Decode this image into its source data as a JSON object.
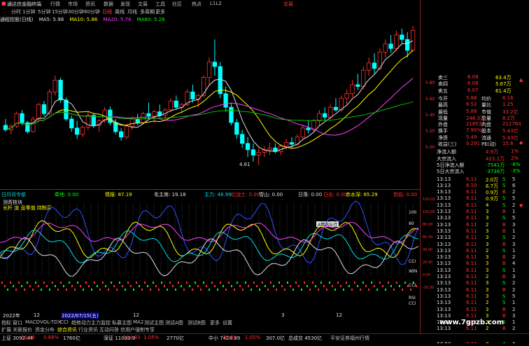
{
  "menu": {
    "app_title": "通达信金融终端",
    "items": [
      "行情",
      "市场",
      "资讯",
      "数据",
      "发现",
      "文易",
      "工具",
      "社区",
      "热点",
      "L1L2"
    ],
    "right_label": "交易"
  },
  "timeframes": [
    "分时",
    "1分钟",
    "5分钟",
    "15分钟",
    "30分钟",
    "60分钟",
    "日线",
    "周线",
    "月线",
    "多周期",
    "更多"
  ],
  "active_timeframe_index": 6,
  "ma_legend": {
    "name": "通程控股(日线)",
    "items": [
      {
        "label": "MA5: 5.98",
        "color": "#e0e0e0"
      },
      {
        "label": "MA10: 5.86",
        "color": "#ffff00"
      },
      {
        "label": "MA20: 5.74",
        "color": "#ff40ff"
      },
      {
        "label": "MA60: 5.26",
        "color": "#00ff00"
      }
    ]
  },
  "price_axis": [
    "5.80",
    "5.60",
    "5.40",
    "5.20",
    "5.00",
    "4.80"
  ],
  "chart_annotations": {
    "low_label": "4.61"
  },
  "indicator_legend": [
    {
      "label": "日月司令部",
      "color": "#00e0e0"
    },
    {
      "label": "牵地: 0.00",
      "color": "#00ff00"
    },
    {
      "label": "情报: 87.19",
      "color": "#ffff00"
    },
    {
      "label": "毛主席: 19.18",
      "color": "#e0e0e0"
    },
    {
      "label": "主力: 48.99",
      "color": "#00e0e0"
    },
    {
      "label": "红战士: 0.00",
      "color": "#ff3030"
    },
    {
      "label": "雪山: 0.00",
      "color": "#e0e0e0"
    },
    {
      "label": "日落: 0.00",
      "color": "#e0e0e0"
    },
    {
      "label": "日出: 0.00",
      "color": "#ff3030"
    },
    {
      "label": "赤水深: 65.29",
      "color": "#ffff00"
    },
    {
      "label": "到低: 0.00",
      "color": "#ff3030"
    }
  ],
  "lower_panel": {
    "title": "测青核块",
    "subtitle": "长杆 道 品零值 持制买",
    "tooltip": "A精选五行",
    "left_axis": [
      "120.00",
      "100.00",
      "80.00",
      "60.00",
      "40.00",
      "20.00",
      "0.00",
      "-20.00"
    ],
    "right_labels": [
      "100",
      "80",
      "CCI",
      "WIN",
      "CCI",
      "RSI",
      "CCI"
    ]
  },
  "date_bar": {
    "items": [
      "2022年",
      "12",
      "2022/07/15(五)",
      "12",
      "3",
      "12"
    ]
  },
  "tabs": [
    "指标",
    "窗口",
    "MACD",
    "VOL-TDX",
    "CCI",
    "趋势动力",
    "主力监控",
    "私募主图",
    "MA2",
    "测试主图",
    "测试A图",
    "测试B图",
    "更多",
    "设置"
  ],
  "tabs2": [
    "扩展",
    "关联报价",
    "资金分布",
    "综合资讯",
    "行业资讯",
    "互动问答",
    "信用户强制专享"
  ],
  "right_panel": {
    "asks": [
      {
        "label": "卖三",
        "price": "6.09",
        "vol": "63.4万"
      },
      {
        "label": "卖四",
        "price": "6.08",
        "vol": "5.67万"
      },
      {
        "label": "卖五",
        "price": "6.07",
        "vol": "61.4万"
      }
    ],
    "stats": [
      {
        "l1": "今开",
        "v1": "5.88",
        "l2": "均价",
        "v2": "6.16"
      },
      {
        "l1": "最高",
        "v1": "6.52",
        "l2": "量比",
        "v2": "1.25"
      },
      {
        "l1": "最低",
        "v1": "5.88",
        "l2": "市值",
        "v2": "33.2亿"
      },
      {
        "l1": "现量",
        "v1": "248.3万",
        "l2": "总量",
        "v2": "8.2万"
      },
      {
        "l1": "外盘",
        "v1": "216533",
        "l2": "内盘",
        "v2": "212764"
      },
      {
        "l1": "换手",
        "v1": "7.90%",
        "l2": "股本",
        "v2": "5.43亿"
      },
      {
        "l1": "净资",
        "v1": "5.49",
        "l2": "流通",
        "v2": "5.43亿"
      },
      {
        "l1": "收益(三)",
        "v1": "0.291",
        "l2": "PE(动)",
        "v2": "15.6"
      }
    ],
    "flows": [
      {
        "label": "净流入额",
        "value": "4.9万",
        "pct": "1%"
      },
      {
        "label": "大宗流入",
        "value": "423.1万",
        "pct": "2%"
      },
      {
        "label": "5日净流入额",
        "value": "-7541万",
        "pct": "-6%"
      },
      {
        "label": "5日大宗流入",
        "value": "-3738万",
        "pct": "-3%"
      }
    ],
    "ticks": [
      {
        "t": "13:13",
        "p": "6.11",
        "v": "2.0万",
        "d": "S",
        "n": "5"
      },
      {
        "t": "13:13",
        "p": "6.10",
        "v": "6.7万",
        "d": "S",
        "n": "6"
      },
      {
        "t": "13:13",
        "p": "6.11",
        "v": "0.9万",
        "d": "B",
        "n": "2"
      },
      {
        "t": "13:13",
        "p": "6.11",
        "v": "0.9万",
        "d": "S",
        "n": "5"
      },
      {
        "t": "13:13",
        "p": "6.11",
        "v": "4",
        "d": "S",
        "n": "2"
      },
      {
        "t": "13:13",
        "p": "6.11",
        "v": "3",
        "d": "B",
        "n": "1"
      },
      {
        "t": "13:13",
        "p": "6.11",
        "v": "3",
        "d": "S",
        "n": "5"
      },
      {
        "t": "13:13",
        "p": "6.11",
        "v": "2",
        "d": "B",
        "n": "3"
      },
      {
        "t": "13:13",
        "p": "6.11",
        "v": "3",
        "d": "B",
        "n": "1"
      },
      {
        "t": "13:13",
        "p": "6.11",
        "v": "3",
        "d": "S",
        "n": "2"
      },
      {
        "t": "13:13",
        "p": "6.11",
        "v": "3",
        "d": "B",
        "n": "3"
      },
      {
        "t": "13:13",
        "p": "6.11",
        "v": "2",
        "d": "S",
        "n": "1"
      },
      {
        "t": "13:13",
        "p": "6.11",
        "v": "3",
        "d": "B",
        "n": "2"
      },
      {
        "t": "13:13",
        "p": "6.11",
        "v": "3",
        "d": "B",
        "n": "4"
      },
      {
        "t": "13:13",
        "p": "6.11",
        "v": "3",
        "d": "S",
        "n": "1"
      },
      {
        "t": "13:13",
        "p": "6.11",
        "v": "2",
        "d": "B",
        "n": "3"
      },
      {
        "t": "13:13",
        "p": "6.11",
        "v": "3",
        "d": "S",
        "n": "2"
      },
      {
        "t": "13:13",
        "p": "6.11",
        "v": "3",
        "d": "B",
        "n": "2"
      },
      {
        "t": "13:13",
        "p": "6.11",
        "v": "3",
        "d": "S",
        "n": "5"
      },
      {
        "t": "13:13",
        "p": "6.11",
        "v": "2",
        "d": "S",
        "n": "1"
      },
      {
        "t": "13:13",
        "p": "6.11",
        "v": "3",
        "d": "B",
        "n": "2"
      },
      {
        "t": "13:13",
        "p": "6.11",
        "v": "3",
        "d": "B",
        "n": "3"
      },
      {
        "t": "13:13",
        "p": "6.11",
        "v": "3",
        "d": "S",
        "n": "1"
      },
      {
        "t": "13:13",
        "p": "6.11",
        "v": "2",
        "d": "B",
        "n": "2"
      },
      {
        "t": "13:13",
        "p": "6.11",
        "v": "3",
        "d": "B",
        "n": "4"
      },
      {
        "t": "13:13",
        "p": "6.11",
        "v": "3",
        "d": "S",
        "n": "1"
      }
    ]
  },
  "status_bar": [
    {
      "label": "上证",
      "value": "3092.44",
      "color": "#e0e0e0"
    },
    {
      "label": "",
      "value": "26.88",
      "color": "#ff3030"
    },
    {
      "label": "",
      "value": "0.88%",
      "color": "#ff3030"
    },
    {
      "label": "",
      "value": "1760亿",
      "color": "#e0e0e0"
    },
    {
      "label": "深证",
      "value": "11093.9",
      "color": "#e0e0e0"
    },
    {
      "label": "",
      "value": "114.93",
      "color": "#ff3030"
    },
    {
      "label": "",
      "value": "1.05%",
      "color": "#ff3030"
    },
    {
      "label": "",
      "value": "2770亿",
      "color": "#e0e0e0"
    },
    {
      "label": "中小",
      "value": "7428.89",
      "color": "#e0e0e0"
    },
    {
      "label": "",
      "value": "76.91",
      "color": "#ff3030"
    },
    {
      "label": "",
      "value": "1.05%",
      "color": "#ff3030"
    },
    {
      "label": "",
      "value": "307.0亿",
      "color": "#e0e0e0"
    },
    {
      "label": "总成交",
      "value": "4530亿",
      "color": "#e0e0e0"
    },
    {
      "label": "平安证券福州行情",
      "value": "",
      "color": "#c0c0c0"
    }
  ],
  "watermark": "www.7gpzb.com",
  "chart_data": {
    "type": "candlestick",
    "ylim": [
      4.6,
      6.15
    ],
    "candles": [
      [
        5.05,
        5.12,
        4.98,
        5.0
      ],
      [
        5.0,
        5.06,
        4.95,
        5.04
      ],
      [
        5.04,
        5.2,
        5.02,
        5.18
      ],
      [
        5.18,
        5.22,
        5.05,
        5.08
      ],
      [
        5.08,
        5.1,
        4.96,
        4.98
      ],
      [
        4.98,
        5.15,
        4.97,
        5.12
      ],
      [
        5.12,
        5.3,
        5.1,
        5.28
      ],
      [
        5.28,
        5.32,
        5.15,
        5.18
      ],
      [
        5.18,
        5.45,
        5.16,
        5.42
      ],
      [
        5.42,
        5.6,
        5.38,
        5.55
      ],
      [
        5.55,
        5.58,
        5.3,
        5.33
      ],
      [
        5.33,
        5.36,
        5.1,
        5.12
      ],
      [
        5.12,
        5.16,
        4.98,
        5.02
      ],
      [
        5.02,
        5.1,
        4.9,
        4.95
      ],
      [
        4.95,
        5.05,
        4.92,
        5.03
      ],
      [
        5.03,
        5.2,
        5.0,
        5.16
      ],
      [
        5.16,
        5.18,
        5.02,
        5.05
      ],
      [
        5.05,
        5.12,
        4.98,
        5.1
      ],
      [
        5.1,
        5.25,
        5.08,
        5.22
      ],
      [
        5.22,
        5.26,
        5.05,
        5.08
      ],
      [
        5.08,
        5.12,
        4.95,
        4.98
      ],
      [
        4.98,
        5.02,
        4.88,
        4.92
      ],
      [
        4.92,
        5.06,
        4.9,
        5.04
      ],
      [
        5.04,
        5.15,
        5.0,
        5.12
      ],
      [
        5.12,
        5.18,
        5.05,
        5.08
      ],
      [
        5.08,
        5.2,
        5.06,
        5.18
      ],
      [
        5.18,
        5.3,
        5.12,
        5.15
      ],
      [
        5.15,
        5.22,
        5.08,
        5.2
      ],
      [
        5.2,
        5.28,
        5.14,
        5.16
      ],
      [
        5.16,
        5.24,
        5.1,
        5.22
      ],
      [
        5.22,
        5.35,
        5.2,
        5.32
      ],
      [
        5.32,
        5.38,
        5.22,
        5.25
      ],
      [
        5.25,
        5.3,
        5.18,
        5.28
      ],
      [
        5.28,
        5.45,
        5.26,
        5.42
      ],
      [
        5.42,
        5.5,
        5.3,
        5.34
      ],
      [
        5.34,
        5.4,
        5.25,
        5.38
      ],
      [
        5.38,
        5.6,
        5.36,
        5.58
      ],
      [
        5.58,
        5.8,
        5.5,
        5.75
      ],
      [
        5.75,
        6.0,
        5.6,
        5.7
      ],
      [
        5.7,
        5.75,
        5.35,
        5.4
      ],
      [
        5.4,
        5.48,
        5.2,
        5.25
      ],
      [
        5.25,
        5.3,
        5.05,
        5.08
      ],
      [
        5.08,
        5.12,
        4.9,
        4.95
      ],
      [
        4.95,
        5.0,
        4.8,
        4.85
      ],
      [
        4.85,
        4.92,
        4.7,
        4.78
      ],
      [
        4.78,
        4.85,
        4.65,
        4.72
      ],
      [
        4.72,
        4.8,
        4.61,
        4.75
      ],
      [
        4.75,
        4.82,
        4.7,
        4.78
      ],
      [
        4.78,
        4.86,
        4.72,
        4.8
      ],
      [
        4.8,
        4.85,
        4.74,
        4.76
      ],
      [
        4.76,
        4.84,
        4.72,
        4.82
      ],
      [
        4.82,
        4.9,
        4.78,
        4.86
      ],
      [
        4.86,
        4.92,
        4.8,
        4.84
      ],
      [
        4.84,
        4.95,
        4.82,
        4.92
      ],
      [
        4.92,
        5.05,
        4.9,
        5.02
      ],
      [
        5.02,
        5.1,
        4.96,
        5.0
      ],
      [
        5.0,
        5.12,
        4.98,
        5.1
      ],
      [
        5.1,
        5.22,
        5.05,
        5.18
      ],
      [
        5.18,
        5.25,
        5.1,
        5.14
      ],
      [
        5.14,
        5.28,
        5.12,
        5.25
      ],
      [
        5.25,
        5.35,
        5.2,
        5.22
      ],
      [
        5.22,
        5.38,
        5.2,
        5.35
      ],
      [
        5.35,
        5.45,
        5.28,
        5.4
      ],
      [
        5.4,
        5.55,
        5.36,
        5.5
      ],
      [
        5.5,
        5.62,
        5.44,
        5.48
      ],
      [
        5.48,
        5.7,
        5.45,
        5.66
      ],
      [
        5.66,
        5.8,
        5.6,
        5.74
      ],
      [
        5.74,
        5.85,
        5.62,
        5.68
      ],
      [
        5.68,
        5.9,
        5.66,
        5.86
      ],
      [
        5.86,
        6.0,
        5.8,
        5.95
      ],
      [
        5.95,
        6.05,
        5.85,
        5.9
      ],
      [
        5.9,
        6.1,
        5.88,
        6.05
      ],
      [
        6.05,
        6.12,
        5.95,
        6.0
      ],
      [
        6.0,
        6.08,
        5.8,
        5.88
      ],
      [
        5.88,
        6.15,
        5.86,
        6.1
      ]
    ]
  }
}
